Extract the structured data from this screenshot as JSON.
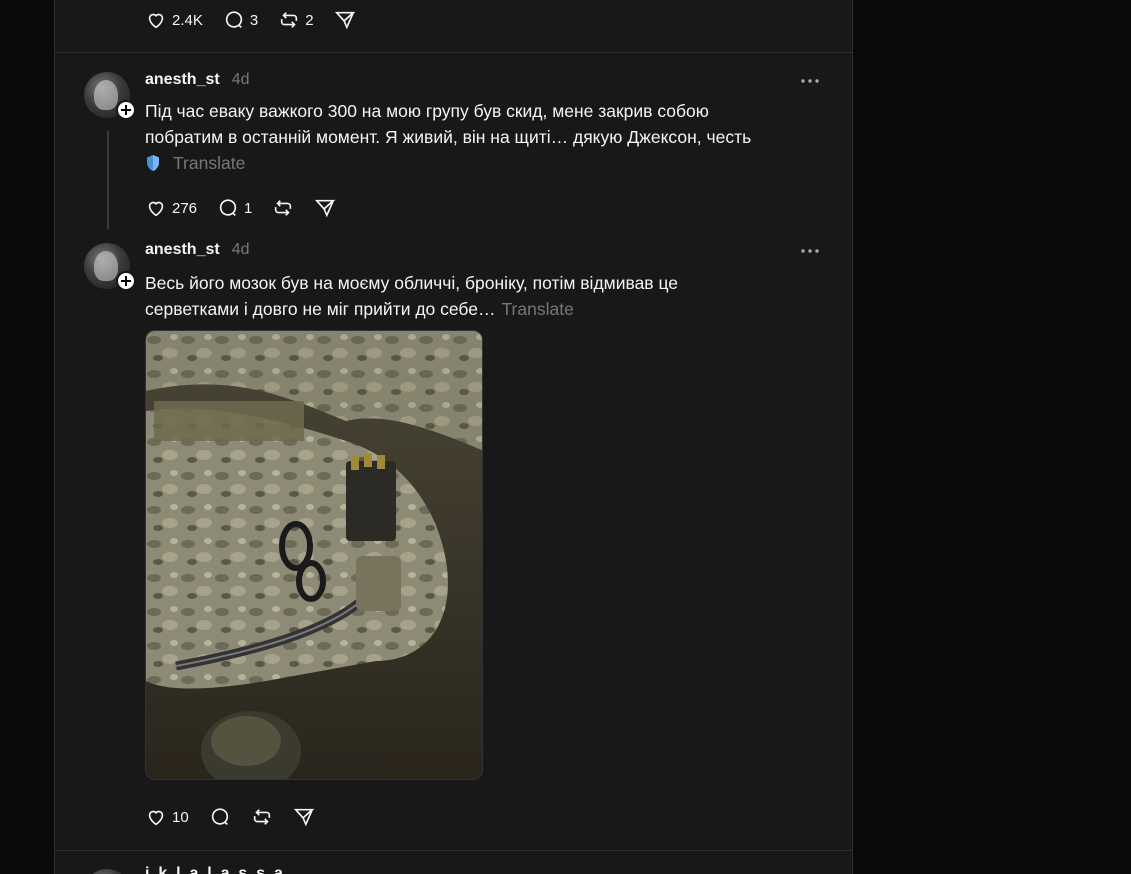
{
  "top_post": {
    "likes": "2.4K",
    "replies": "3",
    "reposts": "2"
  },
  "posts": [
    {
      "username": "anesth_st",
      "time": "4d",
      "text_line1": "Під час еваку важкого 300 на мою групу був скид, мене закрив собою",
      "text_line2": "побратим в останній момент. Я живий, він на щиті… дякую Джексон, честь",
      "translate": "Translate",
      "likes": "276",
      "replies": "1"
    },
    {
      "username": "anesth_st",
      "time": "4d",
      "text_line1": "Весь його мозок був на моєму обличчі, броніку, потім відмивав це",
      "text_line2": "серветками і довго не міг прийти до себе…",
      "translate": "Translate",
      "likes": "10",
      "image_alt": "Camouflage plate carrier with tourniquet, scissors and magazine pouches on dirt ground"
    }
  ],
  "next_post": {
    "username": "i_k_l_a_l_a_s_s_a"
  },
  "colors": {
    "page_bg": "#0a0a0a",
    "feed_bg": "#181818",
    "divider": "#2d2d2d",
    "muted_text": "#777777",
    "shield": "#4a90d9"
  }
}
